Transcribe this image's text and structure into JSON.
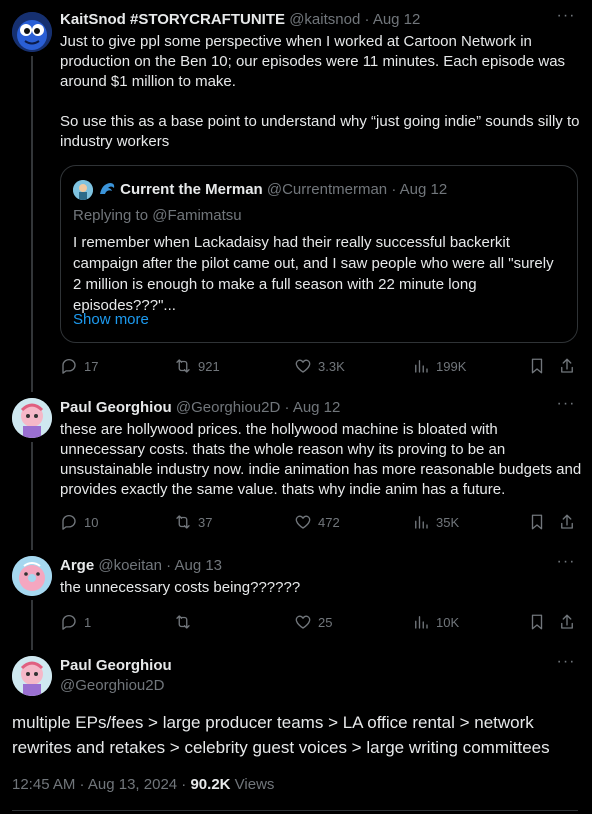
{
  "tweet1": {
    "display_name": "KaitSnod #STORYCRAFTUNITE",
    "handle": "@kaitsnod",
    "date": "Aug 12",
    "text": "Just to give ppl some perspective when I worked at Cartoon Network in production on the Ben 10; our episodes were 11 minutes. Each episode was around $1 million to make.\n\nSo use this as a base point to understand why “just going indie” sounds silly to industry workers",
    "quote": {
      "display_name": "Current the Merman",
      "handle": "@Currentmerman",
      "date": "Aug 12",
      "replying_to": "Replying to @Famimatsu",
      "text": "I remember when Lackadaisy had their really successful backerkit campaign after the pilot came out, and I saw people who were all \"surely 2 million is enough to make a full season with 22 minute long episodes???\"...",
      "show_more": "Show more"
    },
    "replies": "17",
    "reposts": "921",
    "likes": "3.3K",
    "views": "199K"
  },
  "tweet2": {
    "display_name": "Paul Georghiou",
    "handle": "@Georghiou2D",
    "date": "Aug 12",
    "text": "these are hollywood prices. the hollywood machine is bloated with unnecessary costs. thats the whole reason why its proving to be an unsustainable industry now. indie animation has more reasonable budgets and provides exactly the same value. thats why indie anim has a future.",
    "replies": "10",
    "reposts": "37",
    "likes": "472",
    "views": "35K"
  },
  "tweet3": {
    "display_name": "Arge",
    "handle": "@koeitan",
    "date": "Aug 13",
    "text": "the unnecessary costs being??????",
    "replies": "1",
    "reposts": "",
    "likes": "25",
    "views": "10K"
  },
  "main_tweet": {
    "display_name": "Paul Georghiou",
    "handle": "@Georghiou2D",
    "text": "multiple EPs/fees > large producer teams > LA office rental > network rewrites and retakes > celebrity guest voices  > large writing committees",
    "timestamp": "12:45 AM · Aug 13, 2024 · ",
    "views_count": "90.2K",
    "views_label": " Views"
  },
  "separator": "·",
  "colors": {
    "background": "#000000",
    "text": "#e7e9ea",
    "muted": "#71767b",
    "link": "#1d9bf0",
    "border": "#2f3336"
  }
}
